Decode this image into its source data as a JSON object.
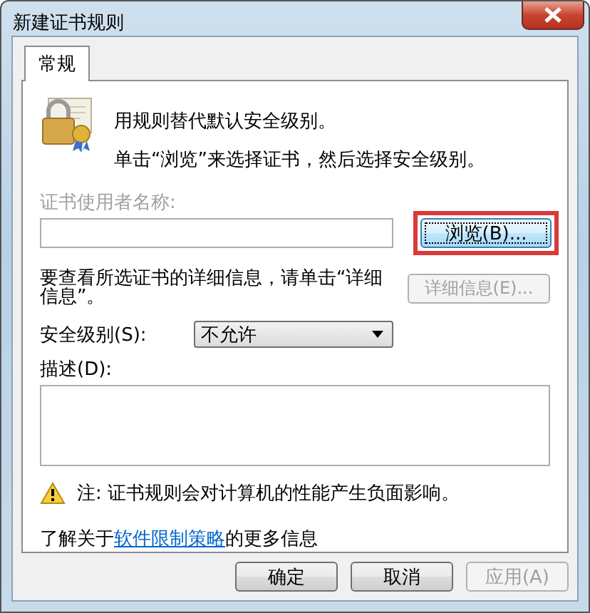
{
  "window": {
    "title": "新建证书规则"
  },
  "tabs": [
    {
      "label": "常规",
      "selected": true
    }
  ],
  "intro": [
    "用规则替代默认安全级别。",
    "单击“浏览”来选择证书，然后选择安全级别。"
  ],
  "subject": {
    "label": "证书使用者名称:",
    "disabled": true,
    "browse_button": {
      "label": "浏览(B)...",
      "highlighted": true,
      "disabled": false
    }
  },
  "details": {
    "text": "要查看所选证书的详细信息，请单击“详细信息”。",
    "button": {
      "label": "详细信息(E)...",
      "disabled": true
    }
  },
  "security_level": {
    "label": "安全级别(S):",
    "value": "不允许"
  },
  "description": {
    "label": "描述(D):"
  },
  "warning": "注: 证书规则会对计算机的性能产生负面影响。",
  "more_info": {
    "before": "了解关于",
    "link": "软件限制策略",
    "after": "的更多信息"
  },
  "buttons": [
    {
      "label": "确定",
      "disabled": false
    },
    {
      "label": "取消",
      "disabled": false
    },
    {
      "label": "应用(A)",
      "disabled": true
    }
  ]
}
